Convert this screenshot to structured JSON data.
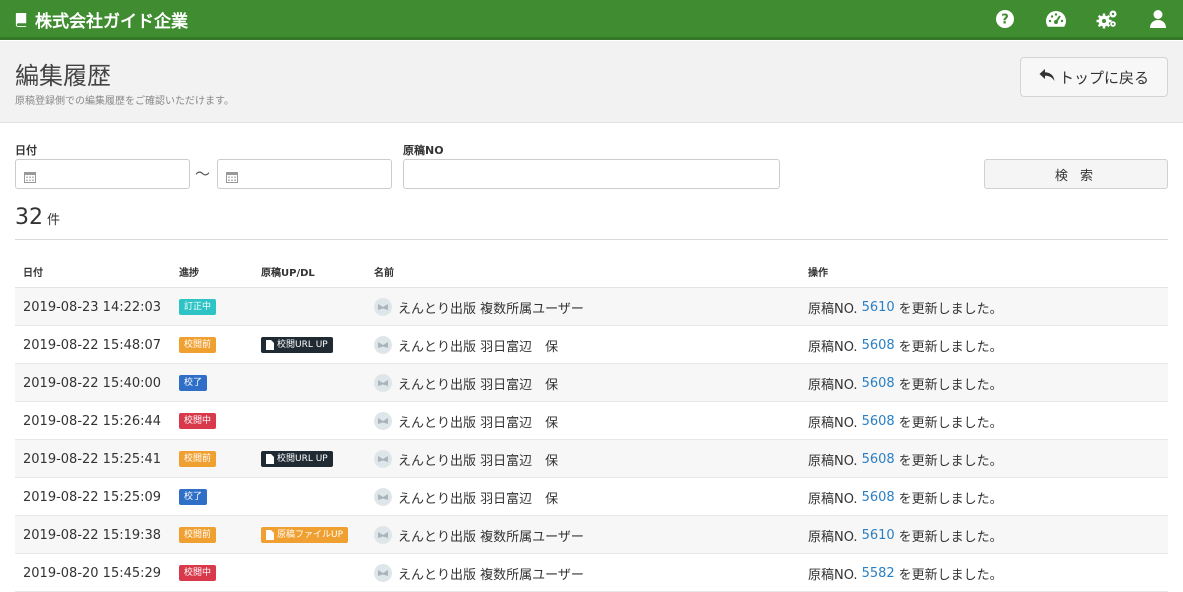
{
  "navbar": {
    "brand": "株式会社ガイド企業",
    "icons": [
      "help-icon",
      "dashboard-icon",
      "settings-icon",
      "user-icon"
    ]
  },
  "header": {
    "title": "編集履歴",
    "description": "原稿登録側での編集履歴をご確認いただけます。",
    "back_button": "トップに戻る"
  },
  "search": {
    "date_label": "日付",
    "date_from_placeholder": "",
    "range_sep": "〜",
    "date_to_placeholder": "",
    "manuscript_label": "原稿NO",
    "manuscript_value": "",
    "search_button": "検 索"
  },
  "results": {
    "count": "32",
    "unit": "件"
  },
  "table": {
    "headers": {
      "date": "日付",
      "status": "進捗",
      "updl": "原稿UP/DL",
      "name": "名前",
      "op": "操作"
    },
    "op_prefix": "原稿NO.",
    "op_suffix": "を更新しました。",
    "rows": [
      {
        "date": "2019-08-23 14:22:03",
        "status": "訂正中",
        "status_color": "#2ec4c6",
        "updl": "",
        "updl_color": "",
        "name": "えんとり出版 複数所属ユーザー",
        "no": "5610"
      },
      {
        "date": "2019-08-22 15:48:07",
        "status": "校閲前",
        "status_color": "#f0a030",
        "updl": "校閲URL UP",
        "updl_color": "#1f2a33",
        "name": "えんとり出版 羽日富辺　保",
        "no": "5608"
      },
      {
        "date": "2019-08-22 15:40:00",
        "status": "校了",
        "status_color": "#2f6fc8",
        "updl": "",
        "updl_color": "",
        "name": "えんとり出版 羽日富辺　保",
        "no": "5608"
      },
      {
        "date": "2019-08-22 15:26:44",
        "status": "校閲中",
        "status_color": "#d9394b",
        "updl": "",
        "updl_color": "",
        "name": "えんとり出版 羽日富辺　保",
        "no": "5608"
      },
      {
        "date": "2019-08-22 15:25:41",
        "status": "校閲前",
        "status_color": "#f0a030",
        "updl": "校閲URL UP",
        "updl_color": "#1f2a33",
        "name": "えんとり出版 羽日富辺　保",
        "no": "5608"
      },
      {
        "date": "2019-08-22 15:25:09",
        "status": "校了",
        "status_color": "#2f6fc8",
        "updl": "",
        "updl_color": "",
        "name": "えんとり出版 羽日富辺　保",
        "no": "5608"
      },
      {
        "date": "2019-08-22 15:19:38",
        "status": "校閲前",
        "status_color": "#f0a030",
        "updl": "原稿ファイルUP",
        "updl_color": "#f0a030",
        "name": "えんとり出版 複数所属ユーザー",
        "no": "5610"
      },
      {
        "date": "2019-08-20 15:45:29",
        "status": "校閲中",
        "status_color": "#d9394b",
        "updl": "",
        "updl_color": "",
        "name": "えんとり出版 複数所属ユーザー",
        "no": "5582"
      }
    ]
  }
}
